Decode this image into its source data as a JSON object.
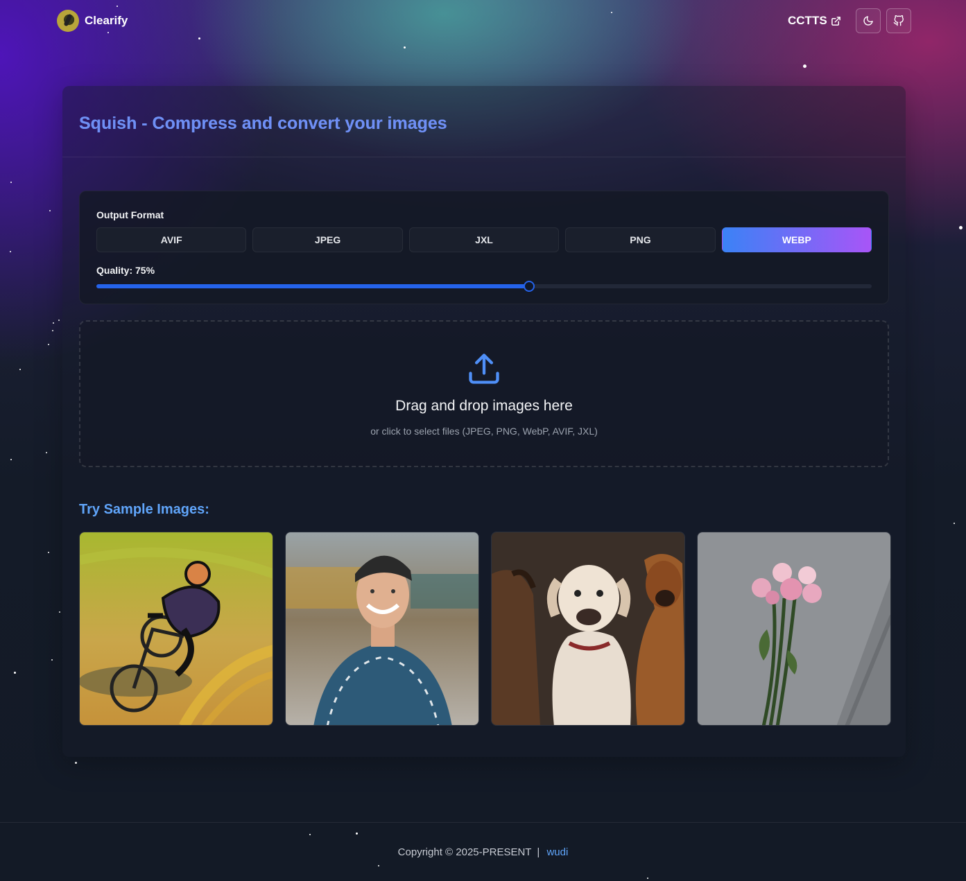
{
  "header": {
    "brand": "Clearify",
    "external_link": "CCTTS",
    "icons": {
      "external": "external-link-icon",
      "theme": "moon-icon",
      "github": "github-icon"
    }
  },
  "main": {
    "title": "Squish - Compress and convert your images",
    "settings": {
      "output_format_label": "Output Format",
      "formats": [
        "AVIF",
        "JPEG",
        "JXL",
        "PNG",
        "WEBP"
      ],
      "selected_format": "WEBP",
      "quality_label": "Quality: 75%",
      "quality": 75
    },
    "dropzone": {
      "icon": "upload-icon",
      "title": "Drag and drop images here",
      "subtitle": "or click to select files (JPEG, PNG, WebP, AVIF, JXL)"
    },
    "samples": {
      "title": "Try Sample Images:",
      "images": [
        "cyclist-illustration",
        "smiling-man-portrait",
        "three-dogs",
        "pink-roses"
      ]
    }
  },
  "footer": {
    "copyright": "Copyright © 2025-PRESENT",
    "separator": "|",
    "author": "wudi"
  },
  "colors": {
    "accent_start": "#3b82f6",
    "accent_end": "#a855f7",
    "slider": "#2563eb",
    "link": "#60a5fa"
  }
}
